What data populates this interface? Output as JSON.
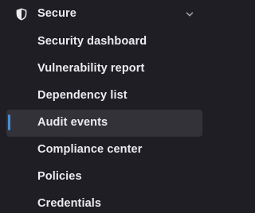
{
  "section": {
    "label": "Secure",
    "icon": "shield-icon",
    "expanded": true
  },
  "nav": {
    "items": [
      {
        "label": "Security dashboard",
        "active": false
      },
      {
        "label": "Vulnerability report",
        "active": false
      },
      {
        "label": "Dependency list",
        "active": false
      },
      {
        "label": "Audit events",
        "active": true
      },
      {
        "label": "Compliance center",
        "active": false
      },
      {
        "label": "Policies",
        "active": false
      },
      {
        "label": "Credentials",
        "active": false
      }
    ]
  },
  "colors": {
    "background": "#1f1e24",
    "text": "#ececef",
    "active_background": "#333238",
    "active_indicator": "#428fdc"
  }
}
